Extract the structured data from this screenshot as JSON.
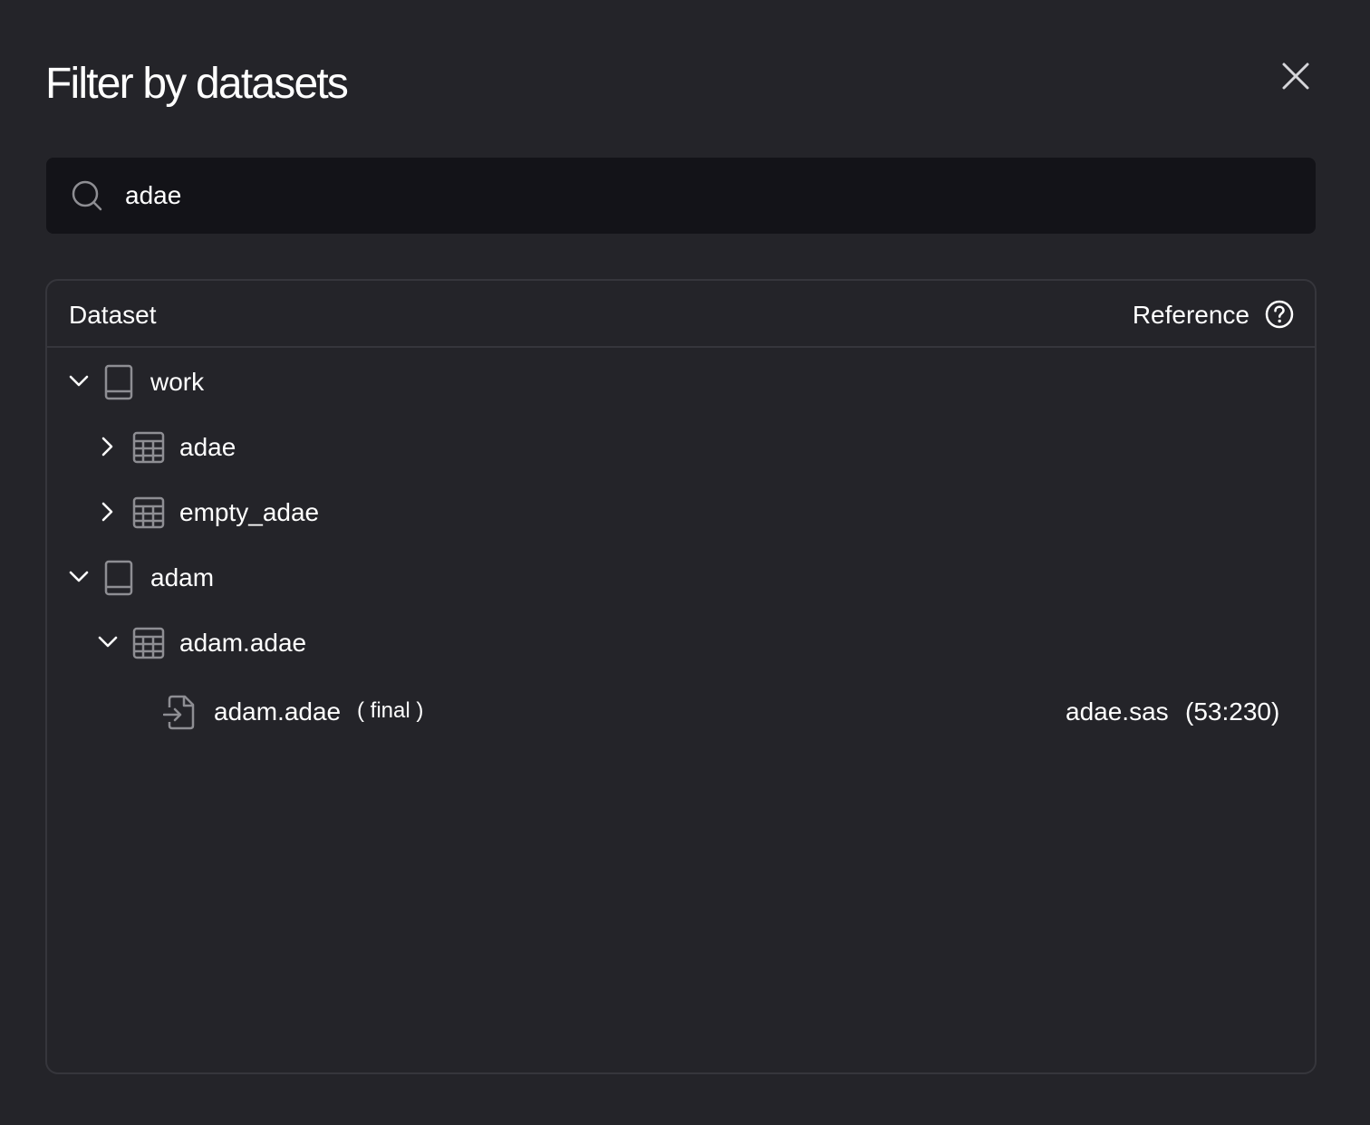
{
  "dialog": {
    "title": "Filter by datasets",
    "close_icon": "close-icon"
  },
  "search": {
    "value": "adae",
    "icon": "search-icon"
  },
  "table": {
    "header": {
      "dataset": "Dataset",
      "reference": "Reference",
      "help_icon": "help-circle-icon"
    },
    "tree": [
      {
        "label": "work",
        "kind": "library",
        "expanded": true,
        "children": [
          {
            "label": "adae",
            "kind": "dataset",
            "expanded": false
          },
          {
            "label": "empty_adae",
            "kind": "dataset",
            "expanded": false
          }
        ]
      },
      {
        "label": "adam",
        "kind": "library",
        "expanded": true,
        "children": [
          {
            "label": "adam.adae",
            "kind": "dataset",
            "expanded": true,
            "children": [
              {
                "label": "adam.adae",
                "tag": "( final )",
                "kind": "output",
                "reference_file": "adae.sas",
                "reference_position": "(53:230)"
              }
            ]
          }
        ]
      }
    ]
  },
  "colors": {
    "background": "#242429",
    "search_background": "#131318",
    "border": "#36363c",
    "icon": "#8e8e93",
    "text": "#ffffff"
  }
}
